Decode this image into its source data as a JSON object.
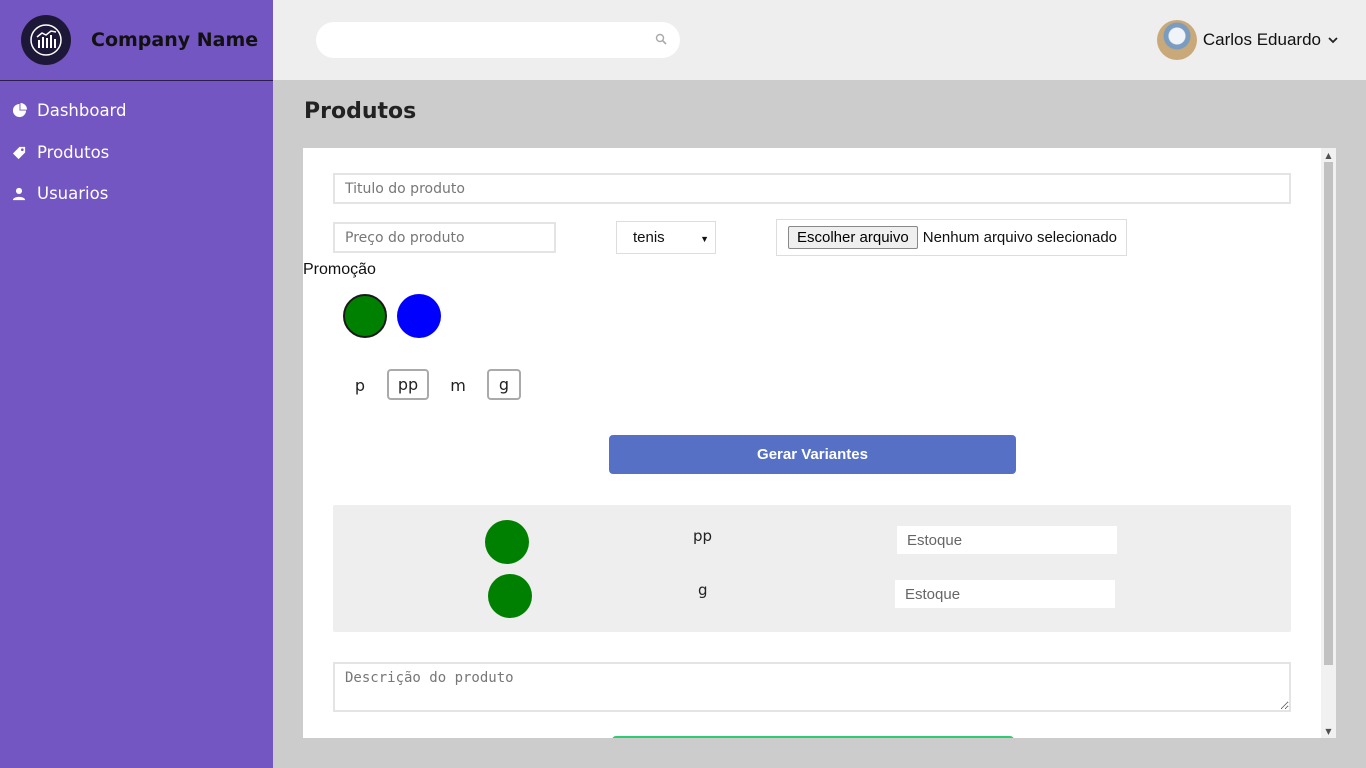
{
  "brand": {
    "name": "Company Name",
    "logo_icon": "chart-logo-icon"
  },
  "sidebar": {
    "items": [
      {
        "label": "Dashboard",
        "icon": "pie-chart-icon"
      },
      {
        "label": "Produtos",
        "icon": "tag-icon"
      },
      {
        "label": "Usuarios",
        "icon": "user-icon"
      }
    ]
  },
  "header": {
    "search": {
      "placeholder": "",
      "icon": "search-icon"
    },
    "user": {
      "name": "Carlos Eduardo",
      "icon": "chevron-down-icon"
    }
  },
  "page": {
    "title": "Produtos"
  },
  "form": {
    "title_placeholder": "Titulo do produto",
    "price_placeholder": "Preço do produto",
    "category_selected": "tenis",
    "file_button": "Escolher arquivo",
    "file_status": "Nenhum arquivo selecionado",
    "promo_label": "Promoção",
    "colors": [
      {
        "name": "green",
        "hex": "#008000",
        "selected": true
      },
      {
        "name": "blue",
        "hex": "#0000ff",
        "selected": false
      }
    ],
    "sizes": [
      {
        "label": "p",
        "selected": false
      },
      {
        "label": "pp",
        "selected": true
      },
      {
        "label": "m",
        "selected": false
      },
      {
        "label": "g",
        "selected": true
      }
    ],
    "generate_button": "Gerar Variantes",
    "variants": [
      {
        "color": "#008000",
        "size": "pp",
        "stock_placeholder": "Estoque"
      },
      {
        "color": "#008000",
        "size": "g",
        "stock_placeholder": "Estoque"
      }
    ],
    "description_placeholder": "Descrição do produto"
  },
  "colors": {
    "sidebar": "#7356c1",
    "header": "#eeeeee",
    "primary_button": "#5670c6",
    "background": "#cccccc"
  }
}
